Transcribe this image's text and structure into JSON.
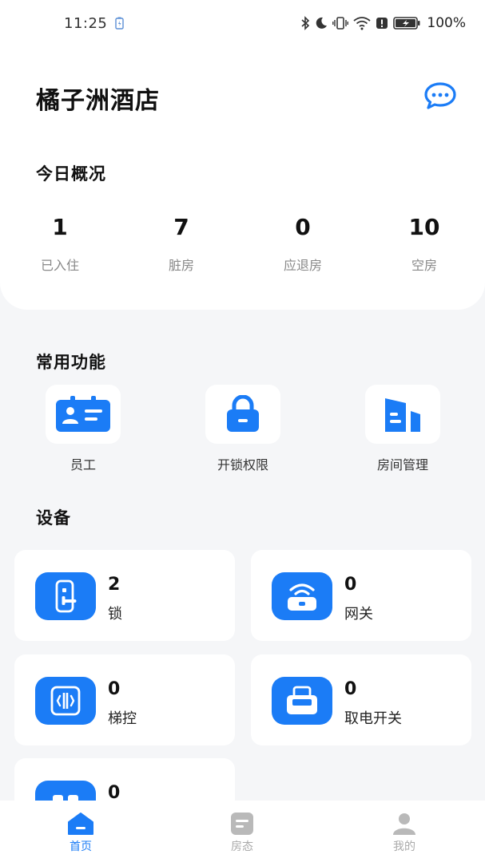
{
  "status_bar": {
    "time": "11:25",
    "battery": "100%"
  },
  "header": {
    "title": "橘子洲酒店",
    "message_icon": "chat-bubble-icon"
  },
  "overview": {
    "title": "今日概况",
    "stats": [
      {
        "value": "1",
        "label": "已入住"
      },
      {
        "value": "7",
        "label": "脏房"
      },
      {
        "value": "0",
        "label": "应退房"
      },
      {
        "value": "10",
        "label": "空房"
      }
    ]
  },
  "functions": {
    "title": "常用功能",
    "items": [
      {
        "label": "员工",
        "icon": "id-card-icon"
      },
      {
        "label": "开锁权限",
        "icon": "padlock-icon"
      },
      {
        "label": "房间管理",
        "icon": "buildings-icon"
      }
    ]
  },
  "devices": {
    "title": "设备",
    "items": [
      {
        "count": "2",
        "name": "锁",
        "icon": "door-lock-icon"
      },
      {
        "count": "0",
        "name": "网关",
        "icon": "gateway-wifi-icon"
      },
      {
        "count": "0",
        "name": "梯控",
        "icon": "elevator-icon"
      },
      {
        "count": "0",
        "name": "取电开关",
        "icon": "card-switch-icon"
      },
      {
        "count": "0",
        "name": "",
        "icon": "device-icon"
      }
    ]
  },
  "bottom_nav": {
    "items": [
      {
        "label": "首页",
        "icon": "home-icon",
        "active": true
      },
      {
        "label": "房态",
        "icon": "room-status-icon",
        "active": false
      },
      {
        "label": "我的",
        "icon": "profile-icon",
        "active": false
      }
    ]
  },
  "colors": {
    "accent": "#1b7cf6",
    "background": "#f5f6f8",
    "card": "#ffffff",
    "muted_text": "#888888"
  }
}
